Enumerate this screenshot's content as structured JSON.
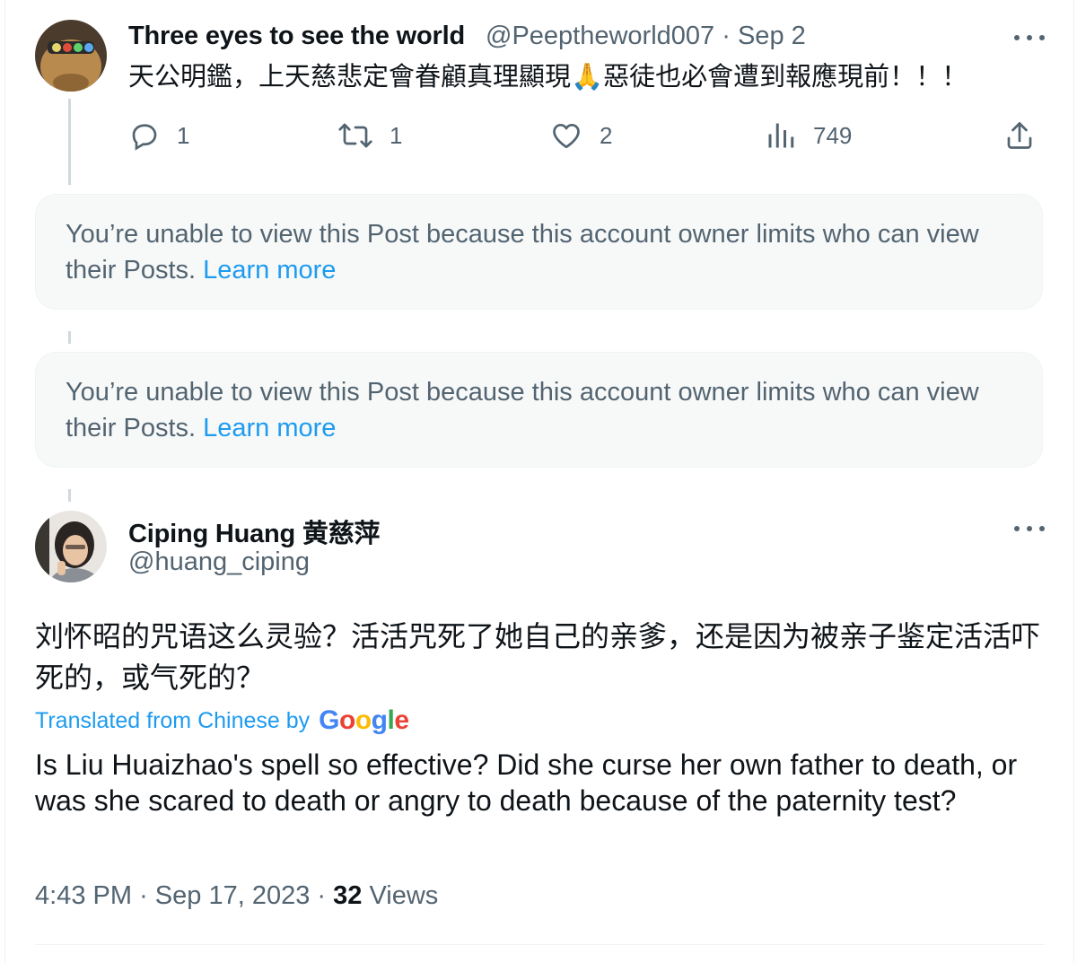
{
  "reply_tweet": {
    "display_name": "Three eyes to see the world",
    "handle": "@Peeptheworld007",
    "separator": "·",
    "date": "Sep 2",
    "text": "天公明鑑，上天慈悲定會眷顧真理顯現🙏惡徒也必會遭到報應現前！！！",
    "metrics": {
      "replies": "1",
      "reposts": "1",
      "likes": "2",
      "views": "749"
    },
    "icons": [
      "reply-icon",
      "repost-icon",
      "like-icon",
      "views-icon",
      "share-icon",
      "more-icon"
    ]
  },
  "restricted_notice_1": {
    "text": "You’re unable to view this Post because this account owner limits who can view their Posts.",
    "link": "Learn more"
  },
  "restricted_notice_2": {
    "text": "You’re unable to view this Post because this account owner limits who can view their Posts.",
    "link": "Learn more"
  },
  "main_tweet": {
    "display_name": "Ciping Huang 黄慈萍",
    "handle": "@huang_ciping",
    "text_original": "刘怀昭的咒语这么灵验？活活咒死了她自己的亲爹，还是因为被亲子鉴定活活吓死的，或气死的？",
    "translated_label": "Translated from Chinese by",
    "translated_provider": "Google",
    "text_translated": "Is Liu Huaizhao's spell so effective? Did she curse her own father to death, or was she scared to death or angry to death because of the paternity test?",
    "time": "4:43 PM",
    "separator": "·",
    "date": "Sep 17, 2023",
    "views_count": "32",
    "views_label": "Views"
  },
  "colors": {
    "text": "#0f1419",
    "muted": "#536471",
    "link": "#1d9bf0",
    "notice_bg": "#f7f9f9",
    "thread_line": "#cfd9de"
  }
}
